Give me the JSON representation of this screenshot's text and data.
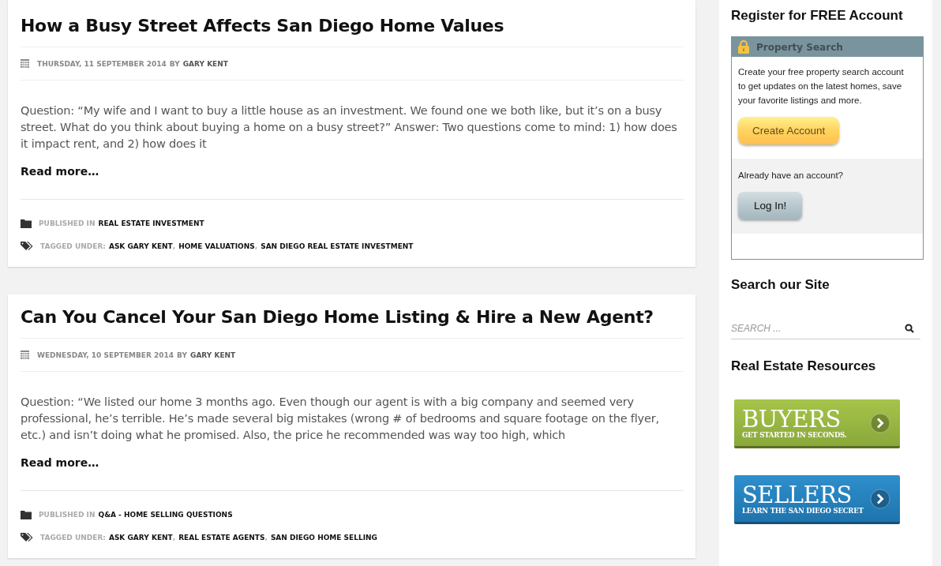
{
  "posts": [
    {
      "title": "How a Busy Street Affects San Diego Home Values",
      "date": "THURSDAY, 11 SEPTEMBER 2014",
      "by": "BY",
      "author": "GARY KENT",
      "excerpt": "Question: “My wife and I want to buy a little house as an investment. We found one we both like, but it’s on a busy street. What do you think about buying a home on a busy street?” Answer: Two questions come to mind: 1) how does it impact rent, and 2) how does it",
      "read_more": "Read more…",
      "published_label": "PUBLISHED IN",
      "category": "REAL ESTATE INVESTMENT",
      "tagged_label": "TAGGED UNDER:",
      "tags": [
        {
          "label": "ASK GARY KENT",
          "sep": ","
        },
        {
          "label": "HOME VALUATIONS",
          "sep": ","
        },
        {
          "label": "SAN DIEGO REAL ESTATE INVESTMENT"
        }
      ]
    },
    {
      "title": "Can You Cancel Your San Diego Home Listing & Hire a New Agent?",
      "date": "WEDNESDAY, 10 SEPTEMBER 2014",
      "by": "BY",
      "author": "GARY KENT",
      "excerpt": "Question: “We listed our home 3 months ago. Even though our agent is with a big company and seemed very professional, he’s terrible. He’s made several big mistakes (wrong # of bedrooms and square footage on the flyer, etc.) and isn’t doing what he promised. Also, the price he recommended was way too high, which",
      "read_more": "Read more…",
      "published_label": "PUBLISHED IN",
      "category": "Q&A - HOME SELLING QUESTIONS",
      "tagged_label": "TAGGED UNDER:",
      "tags": [
        {
          "label": "ASK GARY KENT",
          "sep": ","
        },
        {
          "label": "REAL ESTATE AGENTS",
          "sep": ","
        },
        {
          "label": "SAN DIEGO HOME SELLING"
        }
      ]
    }
  ],
  "sidebar": {
    "register_title": "Register for FREE Account",
    "widget": {
      "title": "Property Search",
      "text": "Create your free property search account to get updates on the latest homes, save your favorite listings and more.",
      "create_button": "Create Account",
      "already": "Already have an account?",
      "login_button": "Log In!"
    },
    "search_title": "Search our Site",
    "search": {
      "placeholder": "SEARCH ..."
    },
    "resources_title": "Real Estate Resources",
    "banners": [
      {
        "kind": "buyers",
        "title": "BUYERS",
        "subtitle": "GET STARTED IN SECONDS."
      },
      {
        "kind": "sellers",
        "title": "SELLERS",
        "subtitle": "LEARN THE SAN DIEGO SECRET"
      }
    ]
  }
}
